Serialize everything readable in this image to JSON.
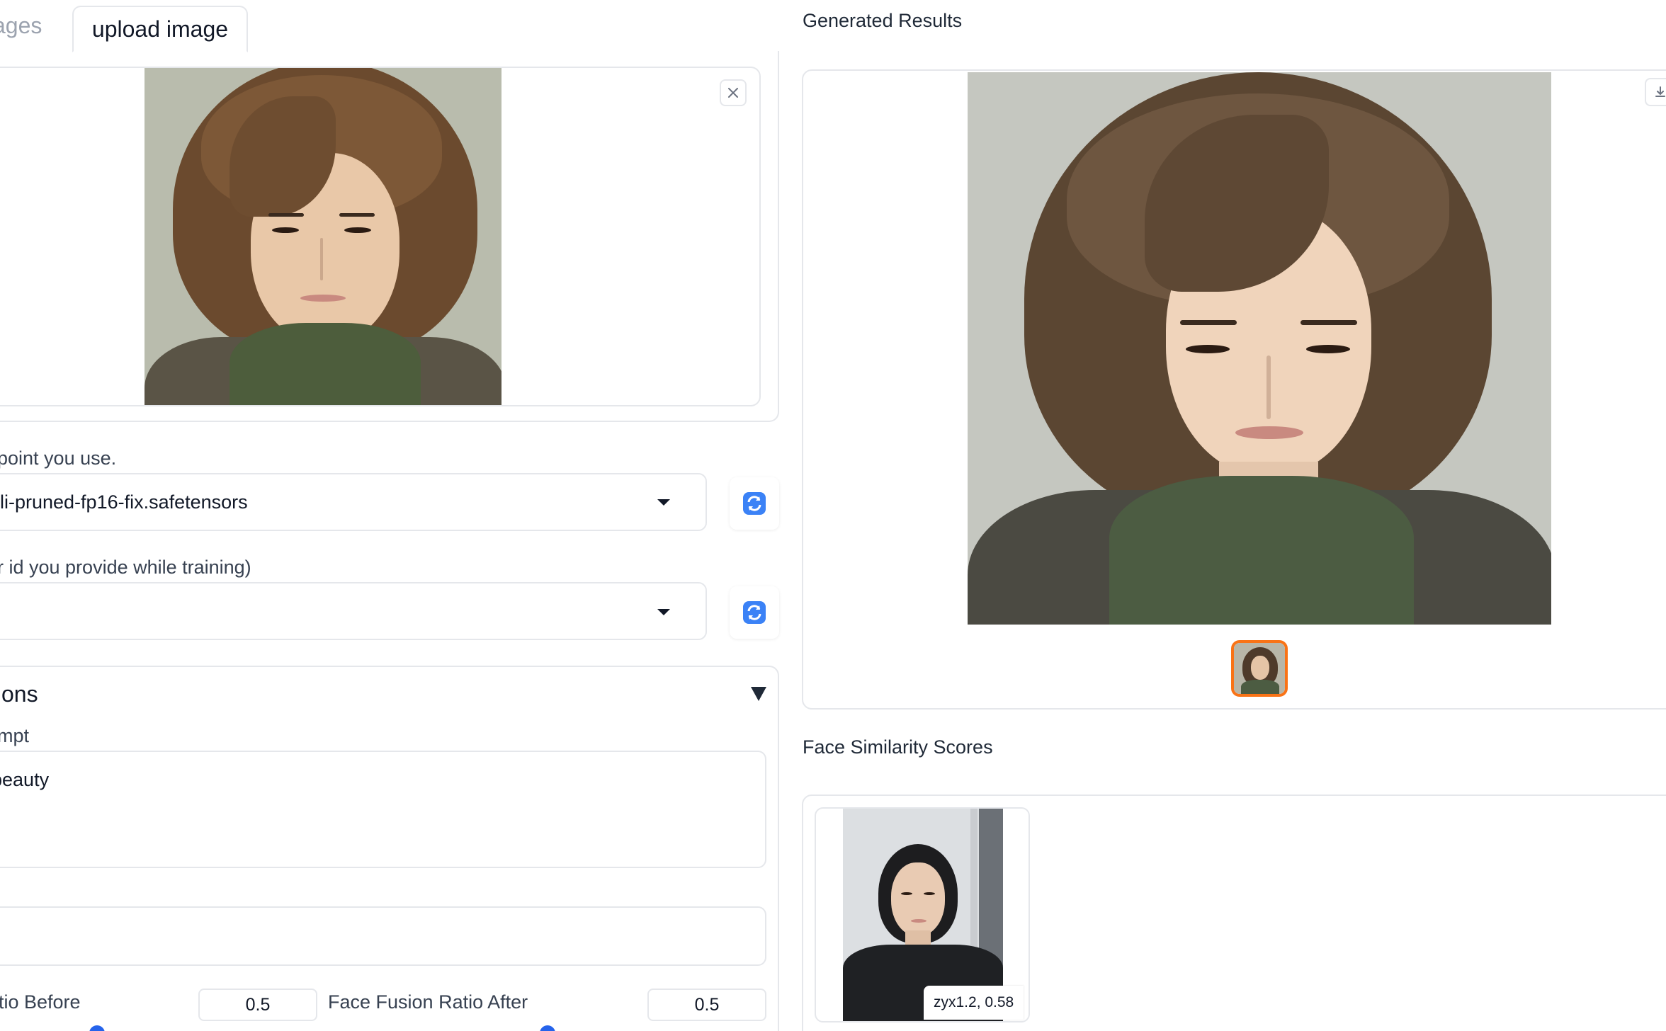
{
  "tabs": {
    "inactive_label": "ages",
    "active_label": "upload image"
  },
  "left": {
    "checkpoint_label": "point you use.",
    "checkpoint_value": "li-pruned-fp16-fix.safetensors",
    "user_id_label": "r id you provide while training)",
    "user_id_value": "",
    "accordion_title": "tions",
    "prompt_label": "mpt",
    "prompt_value": " beauty",
    "negative_prompt_value": "",
    "fusion_before_label": "tio Before",
    "fusion_before_value": "0.5",
    "fusion_after_label": "Face Fusion Ratio After",
    "fusion_after_value": "0.5"
  },
  "right": {
    "results_label": "Generated Results",
    "similarity_label": "Face Similarity Scores",
    "score_caption": "zyx1.2, 0.58"
  },
  "icons": {
    "close": "close-icon",
    "refresh": "refresh-icon",
    "download": "download-icon",
    "accordion": "triangle-down-icon"
  },
  "colors": {
    "accent_selected": "#f97316",
    "slider": "#2563eb",
    "border": "#e5e7eb"
  }
}
